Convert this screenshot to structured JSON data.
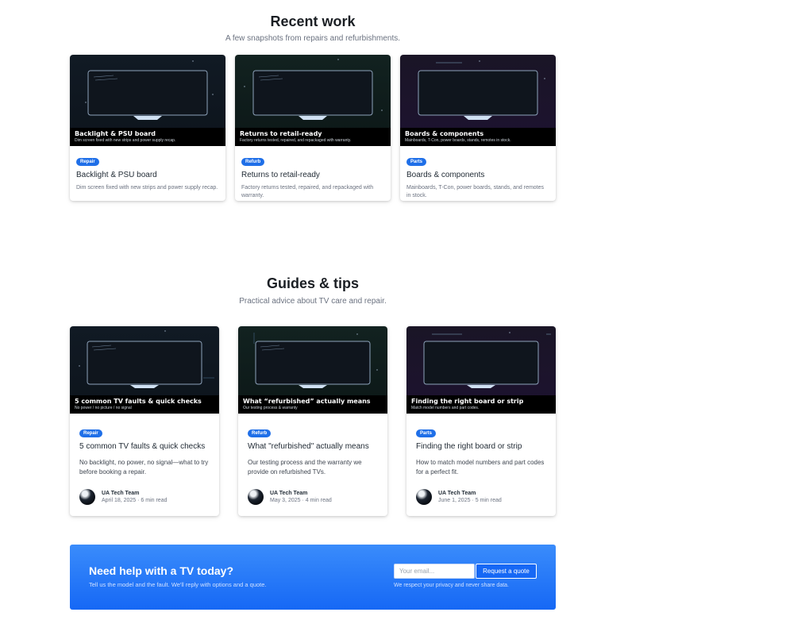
{
  "recent": {
    "title": "Recent work",
    "subtitle": "A few snapshots from repairs and refurbishments.",
    "cards": [
      {
        "badge": "Repair",
        "cap_title": "Backlight & PSU board",
        "cap_sub": "Dim screen fixed with new strips and power supply recap.",
        "title": "Backlight & PSU board",
        "desc": "Dim screen fixed with new strips and power supply recap."
      },
      {
        "badge": "Refurb",
        "cap_title": "Returns to retail-ready",
        "cap_sub": "Factory returns tested, repaired, and repackaged with warranty.",
        "title": "Returns to retail-ready",
        "desc": "Factory returns tested, repaired, and repackaged with warranty."
      },
      {
        "badge": "Parts",
        "cap_title": "Boards & components",
        "cap_sub": "Mainboards, T-Con, power boards, stands, remotes in stock.",
        "title": "Boards & components",
        "desc": "Mainboards, T-Con, power boards, stands, and remotes in stock."
      }
    ]
  },
  "guides": {
    "title": "Guides & tips",
    "subtitle": "Practical advice about TV care and repair.",
    "cards": [
      {
        "badge": "Repair",
        "cap_title": "5 common TV faults & quick checks",
        "cap_sub": "No power / no picture / no signal",
        "title": "5 common TV faults & quick checks",
        "desc": "No backlight, no power, no signal—what to try before booking a repair.",
        "author": "UA Tech Team",
        "meta": "April 18, 2025 · 6 min read"
      },
      {
        "badge": "Refurb",
        "cap_title": "What “refurbished” actually means",
        "cap_sub": "Our testing process & warranty",
        "title": "What \"refurbished\" actually means",
        "desc": "Our testing process and the warranty we provide on refurbished TVs.",
        "author": "UA Tech Team",
        "meta": "May 3, 2025 · 4 min read"
      },
      {
        "badge": "Parts",
        "cap_title": "Finding the right board or strip",
        "cap_sub": "Match model numbers and part codes.",
        "title": "Finding the right board or strip",
        "desc": "How to match model numbers and part codes for a perfect fit.",
        "author": "UA Tech Team",
        "meta": "June 1, 2025 · 5 min read"
      }
    ]
  },
  "cta": {
    "title": "Need help with a TV today?",
    "subtitle": "Tell us the model and the fault. We'll reply with options and a quote.",
    "email_placeholder": "Your email...",
    "button": "Request a quote",
    "note": "We respect your privacy and never share data."
  },
  "icons": {
    "tv": "tv-screen-icon",
    "avatar": "team-avatar"
  },
  "colors": {
    "accent": "#1f6fe8",
    "cta_top": "#3a8cfb",
    "cta_bottom": "#1668f5"
  }
}
